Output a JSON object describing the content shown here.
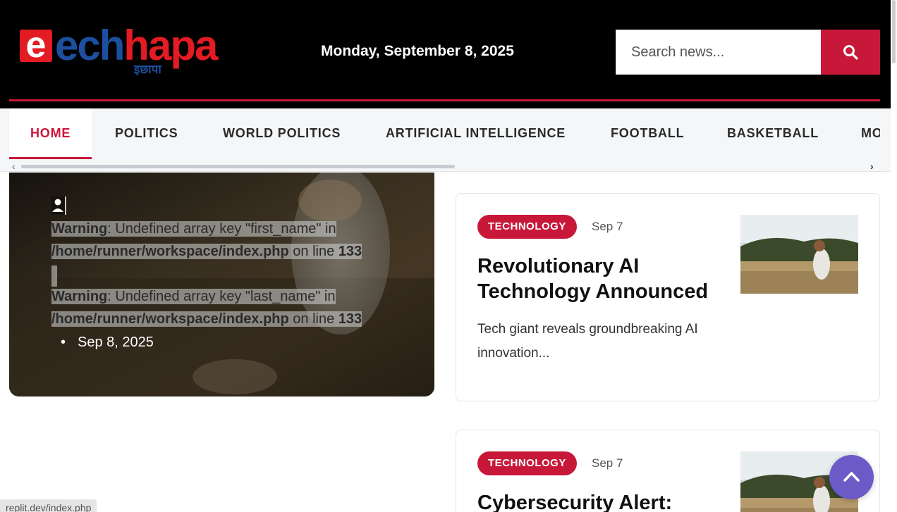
{
  "header": {
    "logo_text_e": "e",
    "logo_text_ech": "ech",
    "logo_text_hapa": "hapa",
    "logo_subtext": "इछापा",
    "date": "Monday, September 8, 2025",
    "search": {
      "placeholder": "Search news..."
    }
  },
  "nav": {
    "items": [
      {
        "label": "HOME",
        "active": true
      },
      {
        "label": "POLITICS"
      },
      {
        "label": "WORLD POLITICS"
      },
      {
        "label": "ARTIFICIAL INTELLIGENCE"
      },
      {
        "label": "FOOTBALL"
      },
      {
        "label": "BASKETBALL"
      },
      {
        "label": "MO"
      }
    ]
  },
  "featured": {
    "warning1": {
      "label": "Warning",
      "msg": ": Undefined array key \"first_name\" in",
      "path": "/home/runner/workspace/index.php",
      "on_line": " on line ",
      "line": "133"
    },
    "warning2": {
      "label": "Warning",
      "msg": ": Undefined array key \"last_name\" in",
      "path": "/home/runner/workspace/index.php",
      "on_line": " on line ",
      "line": "133"
    },
    "date": "Sep 8, 2025"
  },
  "articles": [
    {
      "category": "TECHNOLOGY",
      "date": "Sep 7",
      "title": "Revolutionary AI Technology Announced",
      "excerpt": "Tech giant reveals groundbreaking AI innovation..."
    },
    {
      "category": "TECHNOLOGY",
      "date": "Sep 7",
      "title": "Cybersecurity Alert:",
      "excerpt": ""
    }
  ],
  "status_bar": {
    "url": "replit.dev/index.php"
  },
  "colors": {
    "accent": "#c8183a",
    "header_bg": "#000000",
    "logo_blue": "#1d4fa0",
    "logo_red": "#e31b23",
    "scroll_top": "#6c5bc7"
  }
}
